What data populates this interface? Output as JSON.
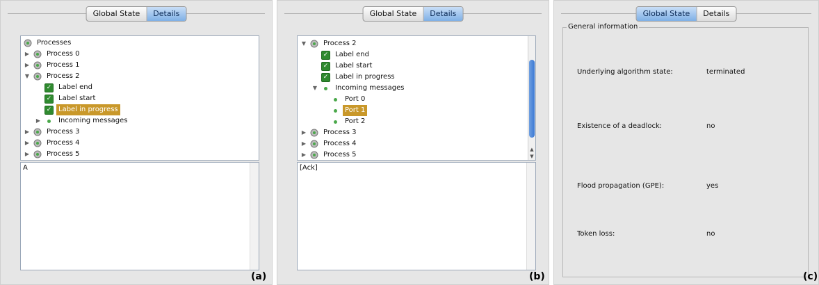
{
  "tabs": {
    "global_state": "Global State",
    "details": "Details"
  },
  "panel_a": {
    "tag": "(a)",
    "tree": [
      {
        "label": "Processes"
      },
      {
        "label": "Process 0"
      },
      {
        "label": "Process 1"
      },
      {
        "label": "Process 2"
      },
      {
        "label": "Label end"
      },
      {
        "label": "Label start"
      },
      {
        "label": "Label in progress"
      },
      {
        "label": "Incoming messages"
      },
      {
        "label": "Process 3"
      },
      {
        "label": "Process 4"
      },
      {
        "label": "Process 5"
      }
    ],
    "text": "A"
  },
  "panel_b": {
    "tag": "(b)",
    "tree": [
      {
        "label": "Process 2"
      },
      {
        "label": "Label end"
      },
      {
        "label": "Label start"
      },
      {
        "label": "Label in progress"
      },
      {
        "label": "Incoming messages"
      },
      {
        "label": "Port 0"
      },
      {
        "label": "Port 1"
      },
      {
        "label": "Port 2"
      },
      {
        "label": "Process 3"
      },
      {
        "label": "Process 4"
      },
      {
        "label": "Process 5"
      }
    ],
    "text": "[Ack]"
  },
  "panel_c": {
    "tag": "(c)",
    "group_title": "General information",
    "rows": [
      {
        "label": "Underlying algorithm state:",
        "value": "terminated"
      },
      {
        "label": "Existence of a deadlock:",
        "value": "no"
      },
      {
        "label": "Flood propagation (GPE):",
        "value": "yes"
      },
      {
        "label": "Token loss:",
        "value": "no"
      }
    ]
  },
  "colors": {
    "selection": "#c9982a",
    "checkbox": "#2f8a2f",
    "tab_active": "#7fb0e6"
  },
  "icons": [
    "gear-process-icon",
    "checkbox-checked-icon",
    "bullet-dot-icon",
    "expand-arrow-icon",
    "collapse-arrow-icon"
  ]
}
